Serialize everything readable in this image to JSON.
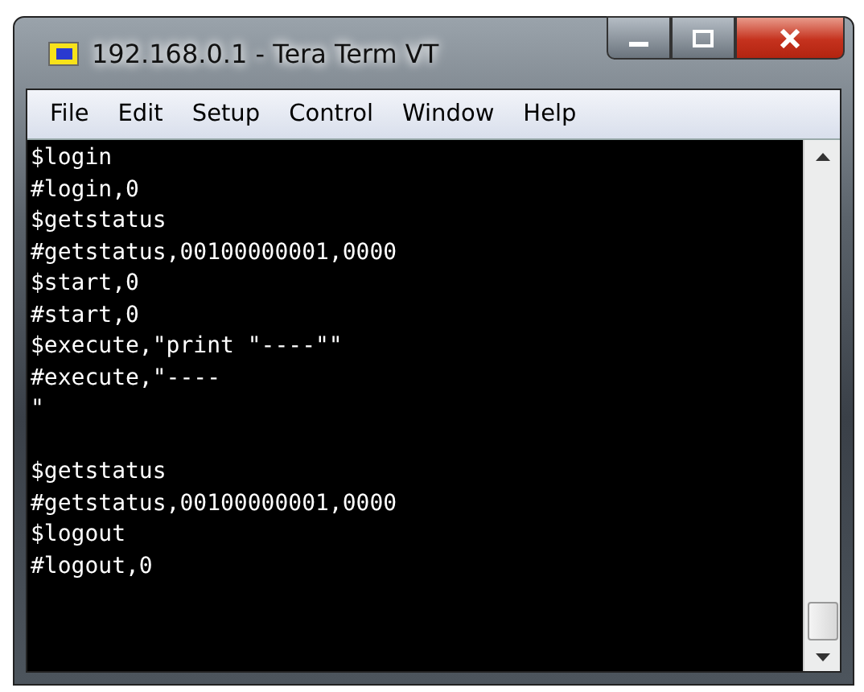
{
  "window": {
    "title": "192.168.0.1 - Tera Term VT"
  },
  "menu": [
    {
      "label": "File"
    },
    {
      "label": "Edit"
    },
    {
      "label": "Setup"
    },
    {
      "label": "Control"
    },
    {
      "label": "Window"
    },
    {
      "label": "Help"
    }
  ],
  "terminal": {
    "lines": [
      {
        "kind": "text",
        "text": "$login"
      },
      {
        "kind": "text",
        "text": "#login,0"
      },
      {
        "kind": "text",
        "text": "$getstatus"
      },
      {
        "kind": "text",
        "text": "#getstatus,00100000001,0000"
      },
      {
        "kind": "text",
        "text": "$start,0"
      },
      {
        "kind": "text",
        "text": "#start,0"
      },
      {
        "kind": "text",
        "text": "$execute,\"print \"----\"\""
      },
      {
        "kind": "text",
        "text": "#execute,\"----"
      },
      {
        "kind": "text",
        "text": "\""
      },
      {
        "kind": "blank"
      },
      {
        "kind": "text",
        "text": "$getstatus"
      },
      {
        "kind": "text",
        "text": "#getstatus,00100000001,0000"
      },
      {
        "kind": "text",
        "text": "$logout"
      },
      {
        "kind": "text",
        "text": "#logout,0"
      }
    ]
  }
}
